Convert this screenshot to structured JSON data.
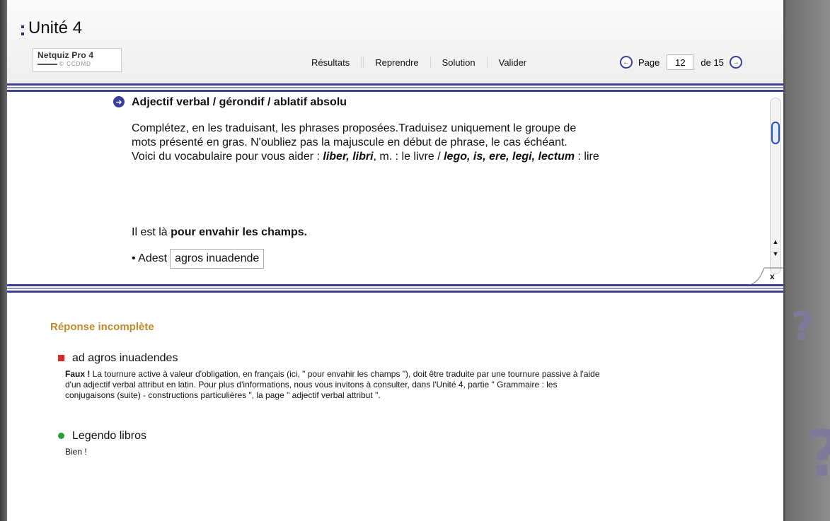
{
  "header": {
    "title": "Unité 4",
    "logo_name": "Netquiz Pro 4",
    "logo_sub": "© CCDMD"
  },
  "toolbar": {
    "results_label": "Résultats",
    "resume_label": "Reprendre",
    "solution_label": "Solution",
    "validate_label": "Valider"
  },
  "pager": {
    "page_label": "Page",
    "current_page": "12",
    "of_label": "de 15",
    "prev_icon": "arrow-left-circle-icon",
    "next_icon": "arrow-right-circle-icon"
  },
  "question": {
    "title": "Adjectif verbal / gérondif / ablatif absolu",
    "instructions_line1": "Complétez, en les traduisant, les phrases proposées.Traduisez uniquement le groupe de",
    "instructions_line2": "mots présenté en gras. N'oubliez pas la majuscule en début de phrase, le cas échéant.",
    "vocab_prefix": "Voici du vocabulaire pour vous aider : ",
    "vocab_word1": "liber, libri",
    "vocab_mid1": ", m. : le livre / ",
    "vocab_word2": "lego, is, ere, legi, lectum",
    "vocab_end": " : lire",
    "sentence_prefix": "Il est là ",
    "sentence_bold": "pour envahir les champs.",
    "answer_prefix": "• Adest",
    "answer_value": "agros inuadende"
  },
  "close_label": "x",
  "feedback": {
    "heading": "Réponse incomplète",
    "items": [
      {
        "status": "wrong",
        "answer": "ad agros inuadendes",
        "verdict": "Faux !",
        "text_line1": " La tournure active à valeur d'obligation, en français (ici, \" pour envahir les champs \"), doit être traduite par une tournure passive à l'aide",
        "text_line2": "d'un adjectif verbal attribut en latin. Pour plus d'informations, nous vous invitons à consulter, dans l'Unité 4, partie \" Grammaire : les",
        "text_line3": "conjugaisons (suite) - constructions particulières \", la page \" adjectif verbal attribut \"."
      },
      {
        "status": "right",
        "answer": "Legendo libros",
        "verdict": "Bien !"
      }
    ]
  },
  "colors": {
    "accent_blue": "#3d3f91",
    "heading_gold": "#c08a2e",
    "wrong_red": "#d32a2a",
    "right_green": "#2a9a3a"
  }
}
